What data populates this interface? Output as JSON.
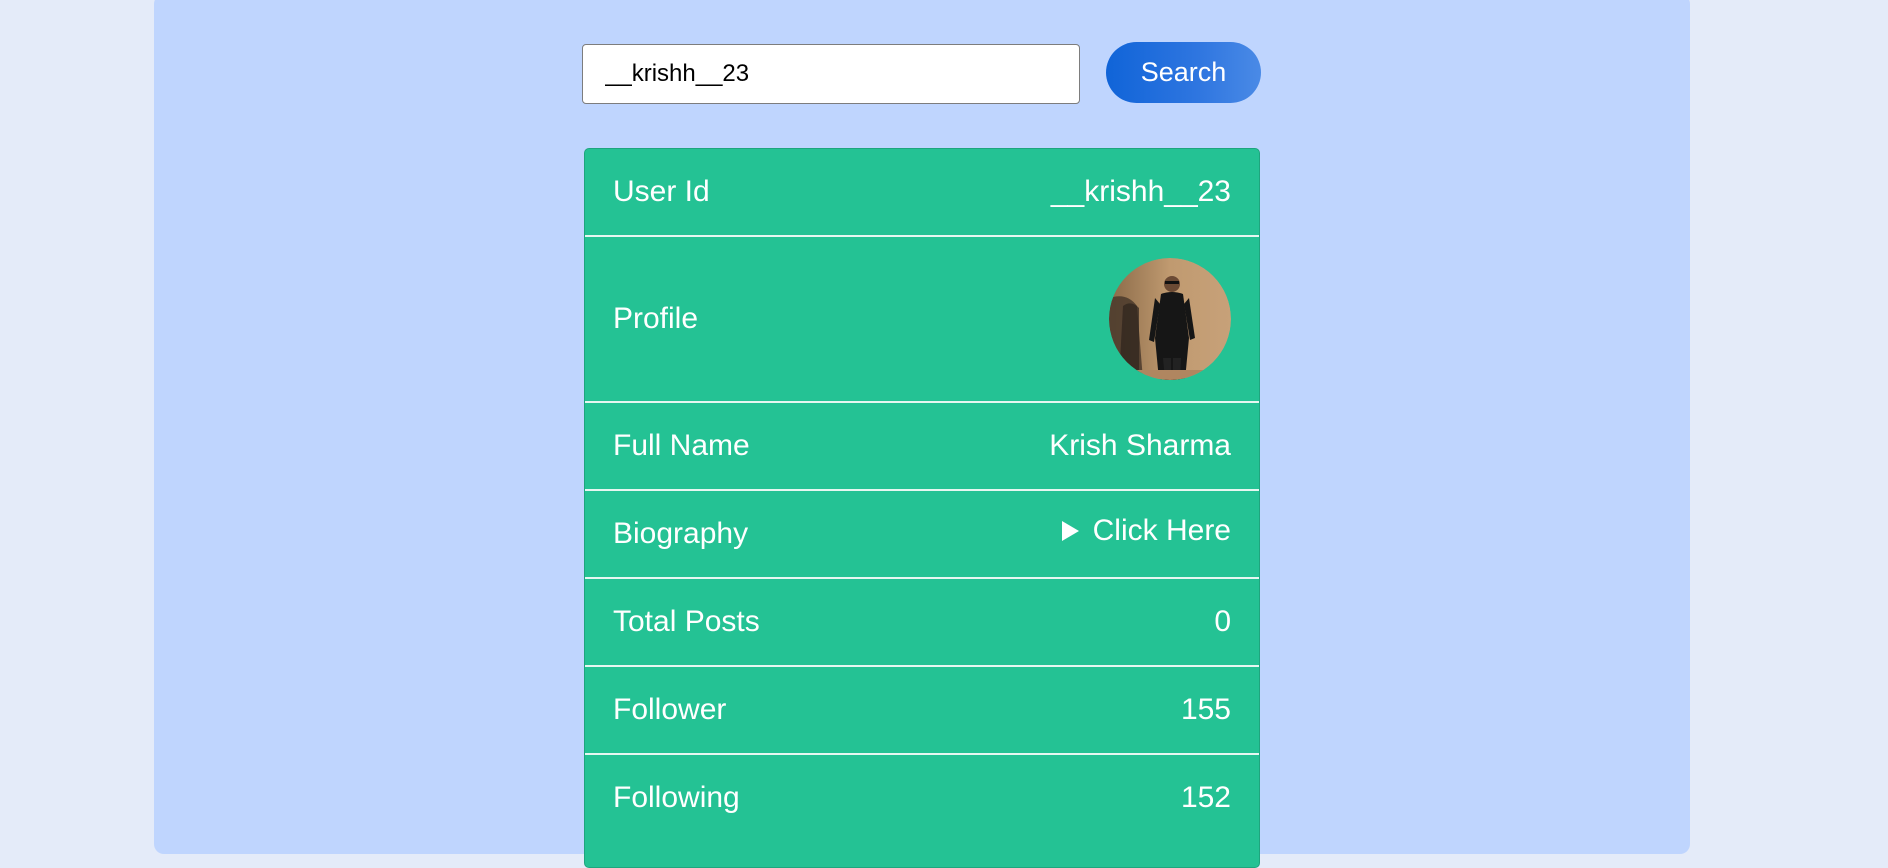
{
  "search": {
    "value": "__krishh__23",
    "button_label": "Search"
  },
  "profile_card": {
    "user_id": {
      "label": "User Id",
      "value": "__krishh__23"
    },
    "profile": {
      "label": "Profile",
      "image": "profile-photo"
    },
    "full_name": {
      "label": "Full Name",
      "value": "Krish Sharma"
    },
    "biography": {
      "label": "Biography",
      "toggle_label": "Click Here"
    },
    "total_posts": {
      "label": "Total Posts",
      "value": "0"
    },
    "follower": {
      "label": "Follower",
      "value": "155"
    },
    "following": {
      "label": "Following",
      "value": "152"
    }
  },
  "colors": {
    "page_bg": "#e4ebf9",
    "panel_bg": "#bfd5fe",
    "card_bg": "#24c294",
    "button_bg": "#1064d8"
  }
}
